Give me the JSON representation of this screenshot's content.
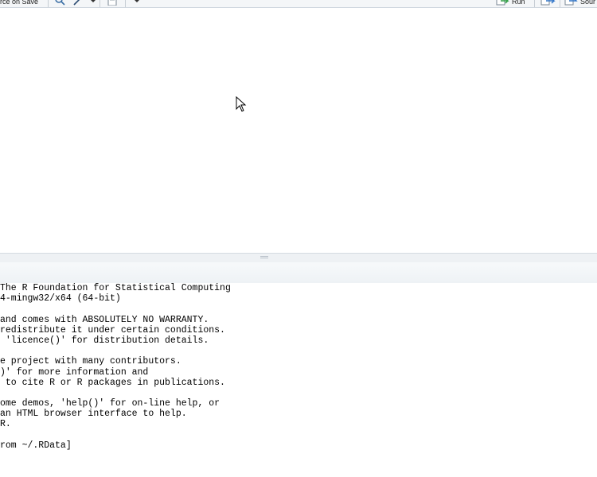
{
  "toolbar": {
    "source_on_save_label": "rce on Save",
    "run_label": "Run",
    "source_label": "Sour"
  },
  "console": {
    "lines": [
      "The R Foundation for Statistical Computing",
      "4-mingw32/x64 (64-bit)",
      "",
      "and comes with ABSOLUTELY NO WARRANTY.",
      "redistribute it under certain conditions.",
      " 'licence()' for distribution details.",
      "",
      "e project with many contributors.",
      ")' for more information and",
      " to cite R or R packages in publications.",
      "",
      "ome demos, 'help()' for on-line help, or",
      "an HTML browser interface to help.",
      "R.",
      "",
      "rom ~/.RData]"
    ]
  }
}
